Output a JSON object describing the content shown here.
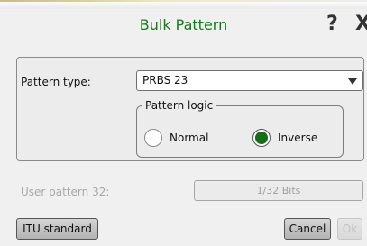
{
  "dialog": {
    "title": "Bulk Pattern",
    "help_label": "?",
    "close_label": "X",
    "accent_color": "#1b7a1b"
  },
  "pattern_type": {
    "label": "Pattern type:",
    "value": "PRBS 23"
  },
  "pattern_logic": {
    "legend": "Pattern logic",
    "options": [
      {
        "label": "Normal",
        "selected": false
      },
      {
        "label": "Inverse",
        "selected": true
      }
    ]
  },
  "user_pattern": {
    "label": "User pattern 32:",
    "value": "1/32 Bits",
    "enabled": false
  },
  "buttons": {
    "itu_standard": "ITU standard",
    "cancel": "Cancel",
    "ok": "Ok"
  }
}
